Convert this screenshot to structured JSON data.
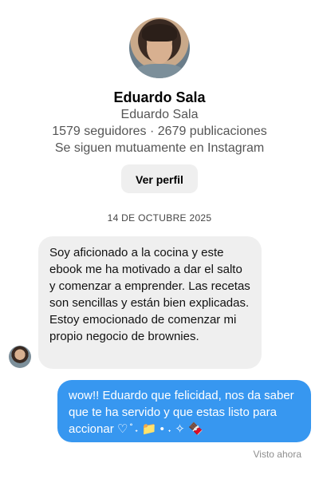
{
  "profile": {
    "name": "Eduardo Sala",
    "username": "Eduardo Sala",
    "stats": "1579 seguidores · 2679 publicaciones",
    "mutual": "Se siguen mutuamente en Instagram",
    "view_profile_label": "Ver perfil"
  },
  "conversation": {
    "date": "14 DE OCTUBRE 2025",
    "messages": [
      {
        "direction": "incoming",
        "text": "Soy aficionado a la cocina y este ebook me ha motivado a dar el salto y comenzar a emprender. Las recetas son sencillas y están bien explicadas. Estoy emocionado de comenzar mi propio negocio de brownies."
      },
      {
        "direction": "outgoing",
        "text": "wow!! Eduardo que felicidad, nos da saber que te ha servido y que estas listo para accionar ♡ ̊ ˖ 📁 • ˖ ✧ 🍫"
      }
    ],
    "status": "Visto ahora"
  },
  "colors": {
    "outgoing_bubble": "#3797f0",
    "incoming_bubble": "#efefef",
    "button_bg": "#efefef"
  }
}
